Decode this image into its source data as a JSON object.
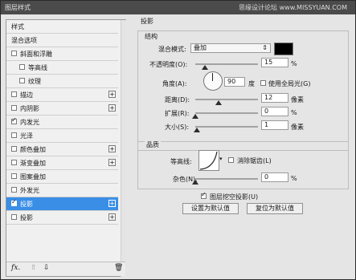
{
  "window": {
    "title": "图层样式"
  },
  "watermark": "思缘设计论坛 www.MISSYUAN.COM",
  "left_panel": {
    "items": [
      {
        "label": "样式",
        "checkbox": null,
        "checked": false,
        "plus": false,
        "indent": 0,
        "selected": false
      },
      {
        "label": "混合选项",
        "checkbox": null,
        "checked": false,
        "plus": false,
        "indent": 0,
        "selected": false
      },
      {
        "label": "斜面和浮雕",
        "checkbox": true,
        "checked": false,
        "plus": false,
        "indent": 0,
        "selected": false
      },
      {
        "label": "等高线",
        "checkbox": true,
        "checked": false,
        "plus": false,
        "indent": 1,
        "selected": false
      },
      {
        "label": "纹理",
        "checkbox": true,
        "checked": false,
        "plus": false,
        "indent": 1,
        "selected": false
      },
      {
        "label": "描边",
        "checkbox": true,
        "checked": false,
        "plus": true,
        "indent": 0,
        "selected": false
      },
      {
        "label": "内阴影",
        "checkbox": true,
        "checked": false,
        "plus": true,
        "indent": 0,
        "selected": false
      },
      {
        "label": "内发光",
        "checkbox": true,
        "checked": true,
        "plus": false,
        "indent": 0,
        "selected": false
      },
      {
        "label": "光泽",
        "checkbox": true,
        "checked": false,
        "plus": false,
        "indent": 0,
        "selected": false
      },
      {
        "label": "颜色叠加",
        "checkbox": true,
        "checked": false,
        "plus": true,
        "indent": 0,
        "selected": false
      },
      {
        "label": "渐变叠加",
        "checkbox": true,
        "checked": false,
        "plus": true,
        "indent": 0,
        "selected": false
      },
      {
        "label": "图案叠加",
        "checkbox": true,
        "checked": false,
        "plus": false,
        "indent": 0,
        "selected": false
      },
      {
        "label": "外发光",
        "checkbox": true,
        "checked": false,
        "plus": false,
        "indent": 0,
        "selected": false
      },
      {
        "label": "投影",
        "checkbox": true,
        "checked": true,
        "plus": true,
        "indent": 0,
        "selected": true
      },
      {
        "label": "投影",
        "checkbox": true,
        "checked": false,
        "plus": true,
        "indent": 0,
        "selected": false
      }
    ],
    "bottom": {
      "fx": "fx.",
      "up": "⇧",
      "down": "⇩",
      "trash": "🗑"
    }
  },
  "right_panel": {
    "section_title": "投影",
    "structure": {
      "title": "结构",
      "blend_mode_label": "混合模式:",
      "blend_mode_value": "叠加",
      "opacity_label": "不透明度(O):",
      "opacity_value": "15",
      "opacity_percent": 15,
      "angle_label": "角度(A):",
      "angle_value": "90",
      "angle_unit": "度",
      "global_light_label": "使用全局光(G)",
      "distance_label": "距离(D):",
      "distance_value": "12",
      "spread_label": "扩展(R):",
      "spread_value": "0",
      "spread_percent": 0,
      "size_label": "大小(S):",
      "size_value": "1",
      "unit_px": "像素",
      "unit_percent": "%",
      "color_swatch": "#000000"
    },
    "quality": {
      "title": "品质",
      "contour_label": "等高线:",
      "antialias_label": "消除锯齿(L)",
      "noise_label": "杂色(N):",
      "noise_value": "0",
      "noise_percent": 0
    },
    "knockout_label": "图层挖空投影(U)",
    "default_button": "设置为默认值",
    "reset_button": "复位为默认值"
  },
  "colors": {
    "selection": "#3a8ee6"
  }
}
